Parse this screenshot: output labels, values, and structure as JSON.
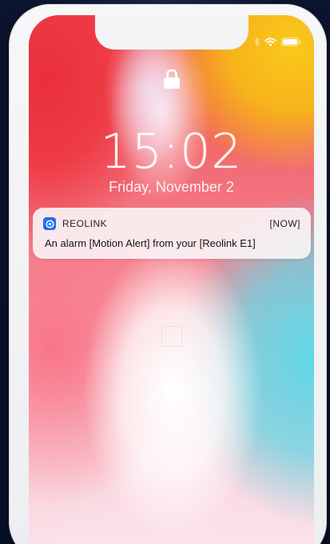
{
  "status_bar": {
    "icons": [
      "bluetooth-icon",
      "wifi-icon",
      "battery-icon"
    ]
  },
  "lock_screen": {
    "lock_icon": "lock-icon",
    "time": "15:02",
    "date": "Friday, November 2"
  },
  "notification": {
    "app_icon": "reolink-app-icon",
    "app_name": "REOLINK",
    "time_label": "[NOW]",
    "message": "An alarm [Motion Alert] from your [Reolink E1]"
  },
  "colors": {
    "background": "#0d1632",
    "phone_frame": "#f3f4f6",
    "notification_bg": "#faf8f9",
    "app_icon_bg": "#1f6ff0",
    "wallpaper_red": "#ea2f3e",
    "wallpaper_yellow": "#f9c919",
    "wallpaper_cyan": "#5fd8e8"
  }
}
